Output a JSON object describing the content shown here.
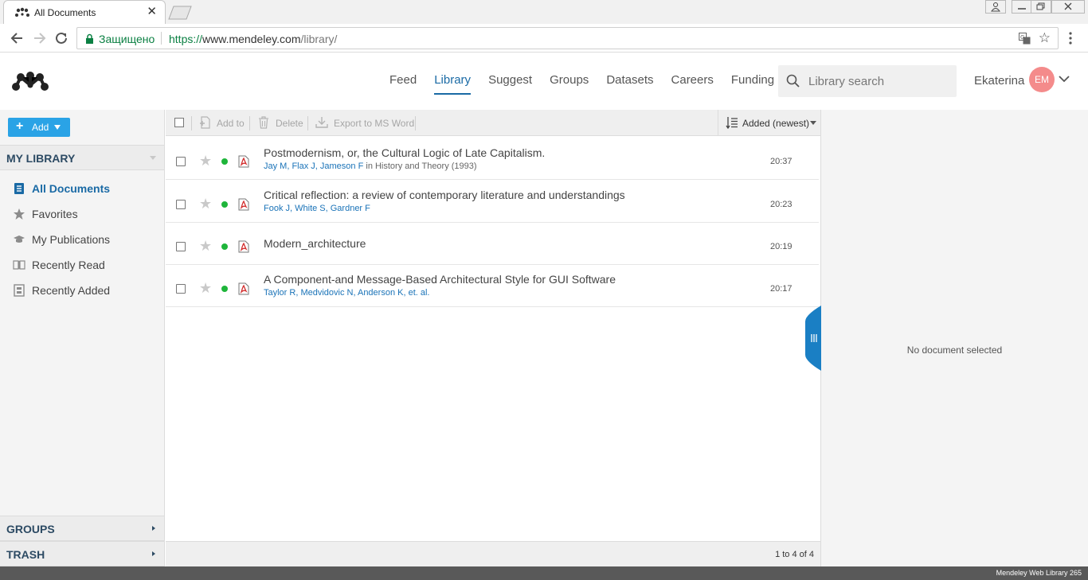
{
  "browser": {
    "tab_title": "All Documents",
    "secure_label": "Защищено",
    "url_scheme": "https://",
    "url_host": "www.mendeley.com",
    "url_path": "/library/"
  },
  "header": {
    "nav": [
      "Feed",
      "Library",
      "Suggest",
      "Groups",
      "Datasets",
      "Careers",
      "Funding"
    ],
    "active_nav": "Library",
    "search_placeholder": "Library search",
    "user_name": "Ekaterina",
    "avatar_initials": "EM",
    "avatar_color": "#f48b8b",
    "accent_color": "#1a6aa5"
  },
  "sidebar": {
    "add_label": "Add",
    "my_library": "MY LIBRARY",
    "items": [
      {
        "label": "All Documents",
        "icon": "documents-icon"
      },
      {
        "label": "Favorites",
        "icon": "star-icon"
      },
      {
        "label": "My Publications",
        "icon": "graduation-cap-icon"
      },
      {
        "label": "Recently Read",
        "icon": "open-book-icon"
      },
      {
        "label": "Recently Added",
        "icon": "archive-icon"
      }
    ],
    "active_item": "All Documents",
    "groups": "GROUPS",
    "trash": "TRASH"
  },
  "toolbar": {
    "add_to": "Add to",
    "delete": "Delete",
    "export": "Export to MS Word",
    "sort": "Added (newest)"
  },
  "documents": [
    {
      "title": "Postmodernism, or, the Cultural Logic of Late Capitalism.",
      "authors": "Jay M, Flax J, Jameson F",
      "source": " in History and Theory (1993)",
      "time": "20:37"
    },
    {
      "title": "Critical reflection: a review of contemporary literature and understandings",
      "authors": "Fook J, White S, Gardner F",
      "source": "",
      "time": "20:23"
    },
    {
      "title": "Modern_architecture",
      "authors": "",
      "source": "",
      "time": "20:19"
    },
    {
      "title": "A Component-and Message-Based Architectural Style for GUI Software",
      "authors": "Taylor R, Medvidovic N, Anderson K, et. al.",
      "source": "",
      "time": "20:17"
    }
  ],
  "pagination": "1 to 4 of 4",
  "details": {
    "empty_text": "No document selected"
  },
  "status": {
    "version": "Mendeley Web Library 265"
  }
}
